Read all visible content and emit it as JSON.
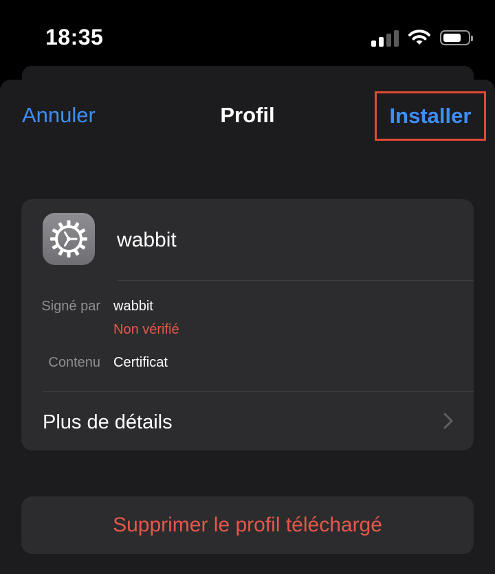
{
  "status_bar": {
    "time": "18:35",
    "icons": [
      "cellular-signal-icon",
      "wifi-icon",
      "battery-icon"
    ]
  },
  "nav": {
    "cancel_label": "Annuler",
    "title": "Profil",
    "install_label": "Installer"
  },
  "profile": {
    "icon": "gear-icon",
    "name": "wabbit",
    "signed_by_label": "Signé par",
    "signed_by_value": "wabbit",
    "verification_status": "Non vérifié",
    "content_label": "Contenu",
    "content_value": "Certificat",
    "more_details_label": "Plus de détails"
  },
  "actions": {
    "delete_label": "Supprimer le profil téléchargé"
  },
  "colors": {
    "accent": "#3e8ef7",
    "destructive": "#e5574a",
    "highlight_border": "#e04a36",
    "background": "#000000",
    "card": "#2c2c2e"
  }
}
